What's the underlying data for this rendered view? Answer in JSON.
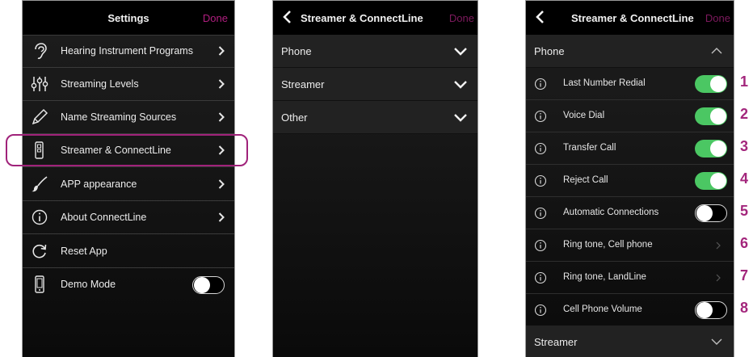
{
  "screen1": {
    "title": "Settings",
    "done": "Done",
    "items": [
      {
        "label": "Hearing Instrument Programs",
        "icon": "ear-icon"
      },
      {
        "label": "Streaming Levels",
        "icon": "sliders-icon"
      },
      {
        "label": "Name Streaming Sources",
        "icon": "pencil-icon"
      },
      {
        "label": "Streamer & ConnectLine",
        "icon": "streamer-device-icon"
      },
      {
        "label": "APP appearance",
        "icon": "paintbrush-icon"
      },
      {
        "label": "About ConnectLine",
        "icon": "info-icon"
      },
      {
        "label": "Reset App",
        "icon": "refresh-icon"
      },
      {
        "label": "Demo Mode",
        "icon": "phone-device-icon",
        "toggle": false
      }
    ]
  },
  "screen2": {
    "title": "Streamer & ConnectLine",
    "done": "Done",
    "sections": [
      "Phone",
      "Streamer",
      "Other"
    ]
  },
  "screen3": {
    "title": "Streamer & ConnectLine",
    "done": "Done",
    "section_phone": "Phone",
    "section_streamer": "Streamer",
    "rows": [
      {
        "label": "Last Number Redial",
        "control": "toggle",
        "on": true,
        "number": "1"
      },
      {
        "label": "Voice Dial",
        "control": "toggle",
        "on": true,
        "number": "2"
      },
      {
        "label": "Transfer Call",
        "control": "toggle",
        "on": true,
        "number": "3"
      },
      {
        "label": "Reject Call",
        "control": "toggle",
        "on": true,
        "number": "4"
      },
      {
        "label": "Automatic Connections",
        "control": "toggle",
        "on": false,
        "number": "5"
      },
      {
        "label": "Ring tone, Cell phone",
        "control": "chevron",
        "number": "6"
      },
      {
        "label": "Ring tone, LandLine",
        "control": "chevron",
        "number": "7"
      },
      {
        "label": "Cell Phone Volume",
        "control": "toggle",
        "on": false,
        "number": "8"
      }
    ]
  },
  "colors": {
    "accent": "#b01e7f",
    "toggle_on": "#4bc763",
    "annotation": "#a3267c"
  }
}
